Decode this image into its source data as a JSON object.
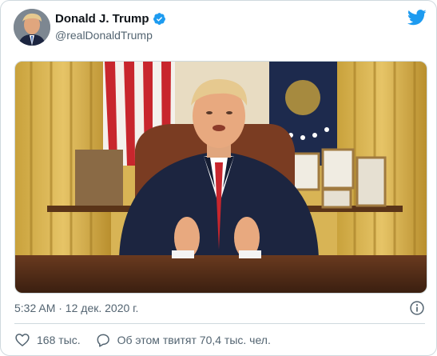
{
  "tweet": {
    "author": {
      "display_name": "Donald J. Trump",
      "handle": "@realDonaldTrump",
      "avatar_icon": "profile-photo",
      "verified_icon": "verified-badge-icon"
    },
    "brand_icon": "twitter-bird-icon",
    "media": {
      "type": "video-frame",
      "description_icon": "oval-office-scene"
    },
    "timestamp": "5:32 AM · 12 дек. 2020 г.",
    "info_icon": "info-icon",
    "actions": {
      "likes": "168 тыс.",
      "discussion": "Об этом твитят 70,4 тыс. чел."
    }
  },
  "colors": {
    "brand": "#1d9bf0",
    "text": "#0f1419",
    "secondary": "#536471",
    "border": "#cfd9de"
  }
}
